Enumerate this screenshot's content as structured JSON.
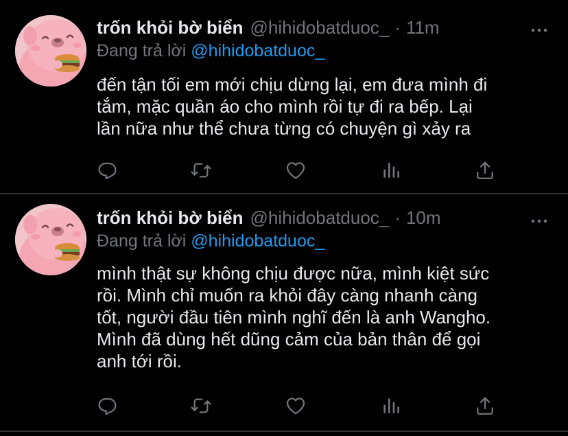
{
  "tweets": [
    {
      "author_name": "trốn khỏi bờ biển",
      "handle": "@hihidobatduoc_",
      "separator": "·",
      "time": "11m",
      "reply_prefix": "Đang trả lời",
      "reply_to": "@hihidobatduoc_",
      "text_lines": [
        "đến tận tối em mới chịu dừng lại, em đưa mình đi",
        "tắm, mặc quần áo cho mình rồi tự đi ra bếp. Lại",
        "lần nữa như thể chưa từng có chuyện gì xảy ra"
      ]
    },
    {
      "author_name": "trốn khỏi bờ biển",
      "handle": "@hihidobatduoc_",
      "separator": "·",
      "time": "10m",
      "reply_prefix": "Đang trả lời",
      "reply_to": "@hihidobatduoc_",
      "text_lines": [
        "mình thật sự không chịu được nữa, mình kiệt sức",
        "rồi. Mình chỉ muốn ra khỏi đây càng nhanh càng",
        "tốt, người đầu tiên mình nghĩ đến là anh Wangho.",
        "Mình đã dùng hết dũng cảm của bản thân để gọi",
        "anh tới rồi."
      ]
    }
  ],
  "icons": {
    "reply": "comment-bubble-icon",
    "retweet": "retweet-icon",
    "like": "heart-icon",
    "stats": "analytics-bars-icon",
    "share": "share-upload-icon",
    "more": "more-dots-icon"
  },
  "colors": {
    "background": "#000000",
    "primary_text": "#e7e9ea",
    "secondary_text": "#71767b",
    "link": "#1d9bf0",
    "divider": "#2f3336"
  }
}
